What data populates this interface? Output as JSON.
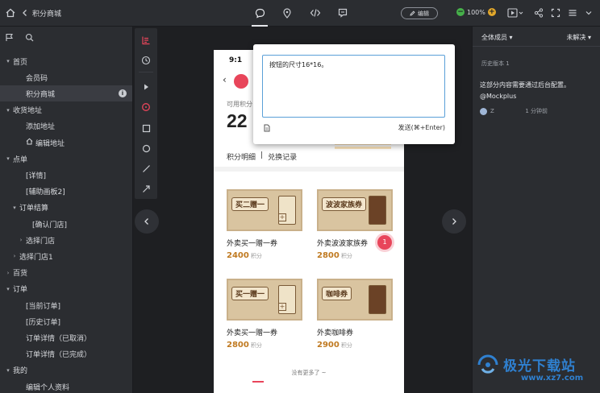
{
  "topbar": {
    "title": "积分商城",
    "edit_label": "编辑",
    "zoom": "100%"
  },
  "sidebar": {
    "items": [
      {
        "label": "首页",
        "level": 0,
        "caret": "expanded"
      },
      {
        "label": "会员码",
        "level": 2
      },
      {
        "label": "积分商城",
        "level": 2,
        "selected": true,
        "badge": "i"
      },
      {
        "label": "收货地址",
        "level": 0,
        "caret": "expanded"
      },
      {
        "label": "添加地址",
        "level": 2
      },
      {
        "label": "编辑地址",
        "level": 2,
        "icon": "home-icon"
      },
      {
        "label": "点单",
        "level": 0,
        "caret": "expanded"
      },
      {
        "label": "[详情]",
        "level": 2
      },
      {
        "label": "[辅助画板2]",
        "level": 2
      },
      {
        "label": "订单结算",
        "level": 1,
        "caret": "expanded"
      },
      {
        "label": "[确认门店]",
        "level": 3
      },
      {
        "label": "选择门店",
        "level": 2,
        "caret": "collapsed"
      },
      {
        "label": "选择门店1",
        "level": 1,
        "caret": "collapsed"
      },
      {
        "label": "百货",
        "level": 0,
        "caret": "collapsed"
      },
      {
        "label": "订单",
        "level": 0,
        "caret": "expanded"
      },
      {
        "label": "[当前订单]",
        "level": 2
      },
      {
        "label": "[历史订单]",
        "level": 2
      },
      {
        "label": "订单详情（已取消）",
        "level": 2
      },
      {
        "label": "订单详情（已完成）",
        "level": 2
      },
      {
        "label": "我的",
        "level": 0,
        "caret": "expanded"
      },
      {
        "label": "编辑个人资料",
        "level": 2
      }
    ]
  },
  "phone": {
    "time": "9:1",
    "available_label": "可用积分",
    "points": "22",
    "tabs": [
      "积分明细",
      "兑换记录"
    ],
    "products": [
      {
        "name": "外卖买一赠一券",
        "price": "2400",
        "unit": "积分",
        "ticket_title": "买二赠一",
        "style": "light"
      },
      {
        "name": "外卖波波家族券",
        "price": "2800",
        "unit": "积分",
        "ticket_title": "波波家族券",
        "style": "dark"
      },
      {
        "name": "外卖买一赠一券",
        "price": "2800",
        "unit": "积分",
        "ticket_title": "买一赠一",
        "style": "light"
      },
      {
        "name": "外卖咖啡券",
        "price": "2900",
        "unit": "积分",
        "ticket_title": "咖啡券",
        "style": "dark"
      }
    ],
    "no_more": "没有更多了 ~",
    "pin_number": "1"
  },
  "popup": {
    "text": "按钮的尺寸16*16。",
    "send_label": "发送(⌘+Enter)"
  },
  "right_panel": {
    "filter_left": "全体成员",
    "filter_right": "未解决",
    "history": "历史版本 1",
    "comment": "这部分内容需要通过后台配置。@Mockplus",
    "author": "Z",
    "time": "1 分钟前"
  },
  "watermark": {
    "title": "极光下载站",
    "url": "www.xz7.com"
  },
  "colors": {
    "accent_red": "#e8455a",
    "price_orange": "#c07a21",
    "zoom_green": "#46b04a",
    "zoom_yellow": "#e3a82b"
  }
}
